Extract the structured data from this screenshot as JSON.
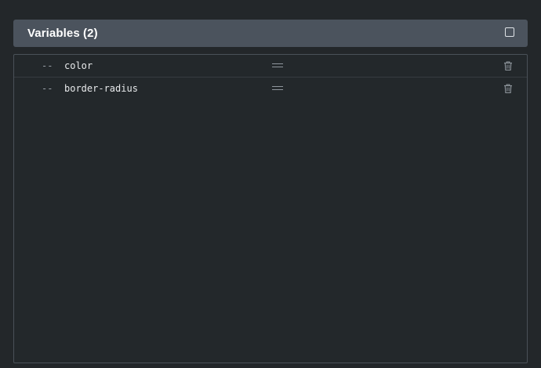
{
  "panel": {
    "title": "Variables (2)",
    "checkbox_icon": "checkbox-icon"
  },
  "variables": [
    {
      "prefix": "--",
      "name": "color",
      "drag_icon": "drag-handle-icon",
      "delete_icon": "trash-icon"
    },
    {
      "prefix": "--",
      "name": "border-radius",
      "drag_icon": "drag-handle-icon",
      "delete_icon": "trash-icon"
    }
  ],
  "colors": {
    "background": "#23272a",
    "header": "#4b535d",
    "border": "#4a5158",
    "text": "#e8eaec",
    "muted": "#9aa1a8"
  }
}
